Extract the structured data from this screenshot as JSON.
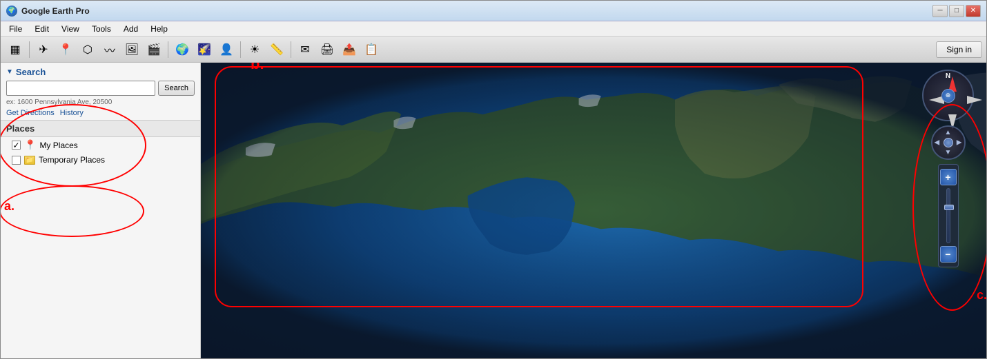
{
  "app": {
    "title": "Google Earth Pro",
    "title_icon": "🌍"
  },
  "titlebar": {
    "controls": {
      "minimize": "─",
      "maximize": "□",
      "close": "✕"
    }
  },
  "menubar": {
    "items": [
      "File",
      "Edit",
      "View",
      "Tools",
      "Add",
      "Help"
    ]
  },
  "toolbar": {
    "buttons": [
      {
        "name": "sidebar-toggle",
        "icon": "▦"
      },
      {
        "name": "fly-to",
        "icon": "✈"
      },
      {
        "name": "add-placemark",
        "icon": "📍"
      },
      {
        "name": "draw-polygon",
        "icon": "⬡"
      },
      {
        "name": "draw-path",
        "icon": "〰"
      },
      {
        "name": "image-overlay",
        "icon": "🖼"
      },
      {
        "name": "record-tour",
        "icon": "🎬"
      },
      {
        "name": "earth-view",
        "icon": "🌍"
      },
      {
        "name": "sky-view",
        "icon": "🌠"
      },
      {
        "name": "street-view",
        "icon": "👤"
      },
      {
        "name": "sunlight",
        "icon": "☀"
      },
      {
        "name": "measure",
        "icon": "📏"
      },
      {
        "name": "email",
        "icon": "✉"
      },
      {
        "name": "print",
        "icon": "🖨"
      },
      {
        "name": "share",
        "icon": "📤"
      },
      {
        "name": "copy-image",
        "icon": "📋"
      }
    ],
    "sign_in_label": "Sign in"
  },
  "search_panel": {
    "title": "Search",
    "collapse_arrow": "▼",
    "input_placeholder": "",
    "search_button_label": "Search",
    "example_text": "ex: 1600 Pennsylvania Ave, 20500",
    "get_directions_label": "Get Directions",
    "history_label": "History"
  },
  "places_panel": {
    "header": "Places",
    "items": [
      {
        "id": "my-places",
        "label": "My Places",
        "type": "pin",
        "checked": true
      },
      {
        "id": "temporary-places",
        "label": "Temporary Places",
        "type": "folder",
        "checked": false
      }
    ]
  },
  "annotations": {
    "a_label": "a.",
    "b_label": "b.",
    "c_label": "c."
  },
  "navigation": {
    "compass": {
      "north_label": "N",
      "center_icon": "⊕"
    },
    "zoom": {
      "plus_label": "+",
      "minus_label": "−"
    }
  },
  "colors": {
    "accent_blue": "#1a5296",
    "link_blue": "#1a5296",
    "annotation_red": "#cc0000",
    "toolbar_bg": "#d8d8d8",
    "sidebar_bg": "#f5f5f5"
  }
}
